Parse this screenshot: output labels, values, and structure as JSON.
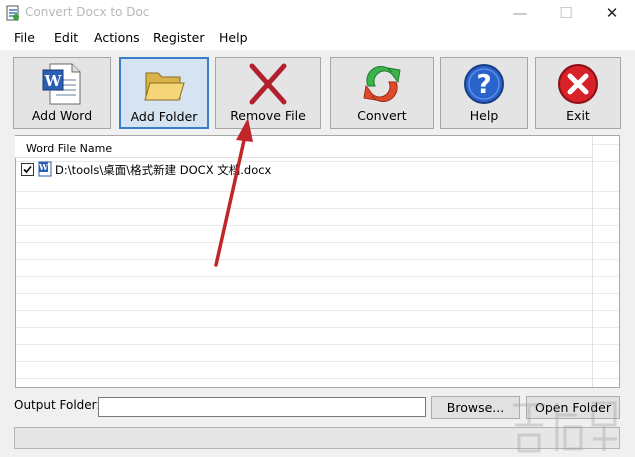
{
  "window": {
    "title": "Convert Docx to Doc",
    "controls": {
      "minimize": "—",
      "maximize": "☐",
      "close": "✕"
    }
  },
  "menu": [
    "File",
    "Edit",
    "Actions",
    "Register",
    "Help"
  ],
  "toolbar": [
    {
      "label": "Add Word",
      "icon": "word-document-icon"
    },
    {
      "label": "Add Folder",
      "icon": "folder-icon",
      "active": true
    },
    {
      "label": "Remove File",
      "icon": "remove-x-icon"
    },
    {
      "label": "Convert",
      "icon": "convert-arrows-icon"
    },
    {
      "label": "Help",
      "icon": "question-icon"
    },
    {
      "label": "Exit",
      "icon": "exit-x-icon"
    }
  ],
  "file_list": {
    "column_header": "Word File Name",
    "rows": [
      {
        "checked": true,
        "path": "D:\\tools\\桌面\\格式新建 DOCX 文档.docx"
      }
    ]
  },
  "output": {
    "label": "Output Folder:",
    "value": "",
    "browse_label": "Browse...",
    "open_folder_label": "Open Folder"
  },
  "colors": {
    "selection_border": "#3b7ec9",
    "annotation_arrow": "#c0262a"
  }
}
